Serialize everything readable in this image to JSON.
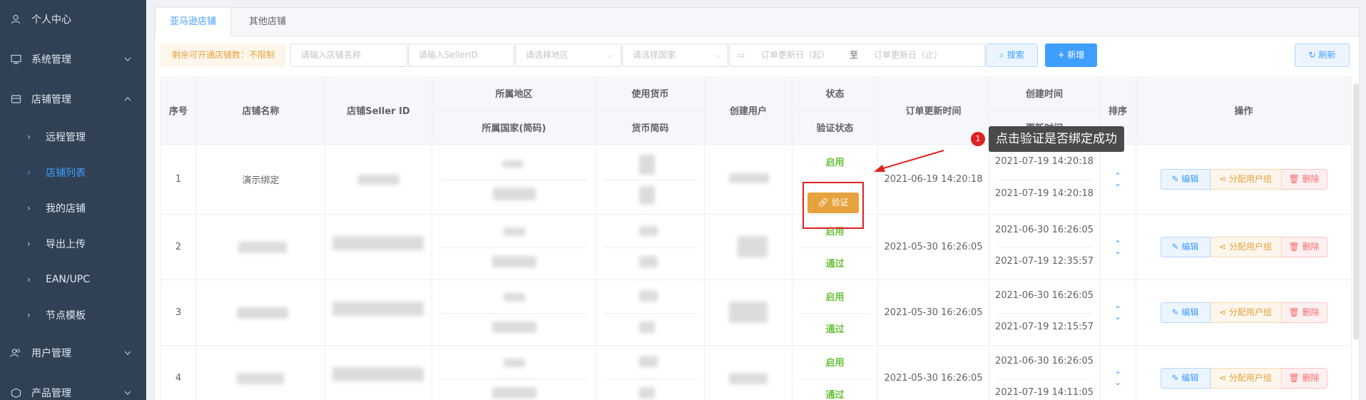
{
  "sidebar": {
    "items": [
      {
        "label": "个人中心",
        "icon": "user-icon"
      },
      {
        "label": "系统管理",
        "icon": "monitor-icon"
      },
      {
        "label": "店铺管理",
        "icon": "store-icon"
      },
      {
        "label": "用户管理",
        "icon": "users-icon"
      },
      {
        "label": "产品管理",
        "icon": "box-icon"
      }
    ],
    "sub_items": [
      {
        "label": "远程管理"
      },
      {
        "label": "店铺列表"
      },
      {
        "label": "我的店铺"
      },
      {
        "label": "导出上传"
      },
      {
        "label": "EAN/UPC"
      },
      {
        "label": "节点模板"
      }
    ]
  },
  "tabs": [
    {
      "label": "亚马逊店铺"
    },
    {
      "label": "其他店铺"
    }
  ],
  "filters": {
    "quota": "剩余可开通店铺数：不限制",
    "shop_name_placeholder": "请输入店铺名称",
    "seller_id_placeholder": "请输入SellerID",
    "region_placeholder": "请选择地区",
    "country_placeholder": "请选择国家",
    "date_start_placeholder": "订单更新日（起）",
    "date_sep": "至",
    "date_end_placeholder": "订单更新日（止）",
    "search_label": "搜索",
    "add_label": "+ 新增",
    "refresh_label": "刷新"
  },
  "table": {
    "headers": {
      "index": "序号",
      "shop_name": "店铺名称",
      "seller_id": "店铺Seller ID",
      "region": "所属地区",
      "country": "所属国家(简码)",
      "currency": "使用货币",
      "currency_code": "货币简码",
      "creator": "创建用户",
      "status": "状态",
      "verify_status": "验证状态",
      "order_update": "订单更新时间",
      "created_at": "创建时间",
      "updated_at": "更新时间",
      "sort": "排序",
      "actions": "操作"
    },
    "rows": [
      {
        "index": "1",
        "shop_name": "演示绑定",
        "status": "启用",
        "verify": "验证",
        "order_update": "2021-06-19 14:20:18",
        "created_at": "2021-07-19 14:20:18",
        "updated_at": "2021-07-19 14:20:18"
      },
      {
        "index": "2",
        "shop_name": "",
        "status": "启用",
        "verify": "通过",
        "order_update": "2021-05-30 16:26:05",
        "created_at": "2021-06-30 16:26:05",
        "updated_at": "2021-07-19 12:35:57"
      },
      {
        "index": "3",
        "shop_name": "",
        "status": "启用",
        "verify": "通过",
        "order_update": "2021-05-30 16:26:05",
        "created_at": "2021-06-30 16:26:05",
        "updated_at": "2021-07-19 12:15:57"
      },
      {
        "index": "4",
        "shop_name": "",
        "status": "启用",
        "verify": "通过",
        "order_update": "2021-05-30 16:26:05",
        "created_at": "2021-06-30 16:26:05",
        "updated_at": "2021-07-19 14:11:05"
      }
    ],
    "actions": {
      "edit": "编辑",
      "assign": "分配用户组",
      "delete": "删除"
    }
  },
  "annotation": {
    "badge": "1",
    "text": "点击验证是否绑定成功"
  },
  "colors": {
    "sidebar_bg": "#304156",
    "primary": "#409eff",
    "warning": "#e6a23c",
    "danger": "#f56c6c",
    "success": "#67c23a",
    "highlight": "#e02020"
  }
}
